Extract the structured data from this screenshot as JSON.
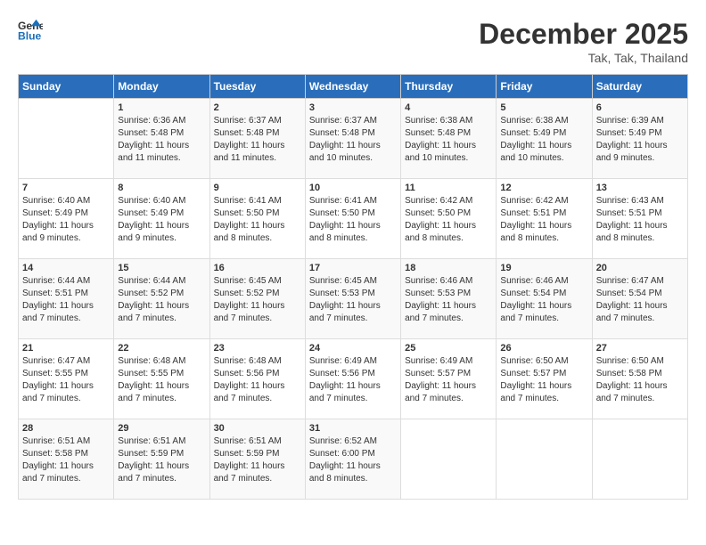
{
  "header": {
    "logo_line1": "General",
    "logo_line2": "Blue",
    "month_title": "December 2025",
    "location": "Tak, Tak, Thailand"
  },
  "weekdays": [
    "Sunday",
    "Monday",
    "Tuesday",
    "Wednesday",
    "Thursday",
    "Friday",
    "Saturday"
  ],
  "weeks": [
    [
      {
        "day": "",
        "sunrise": "",
        "sunset": "",
        "daylight": ""
      },
      {
        "day": "1",
        "sunrise": "6:36 AM",
        "sunset": "5:48 PM",
        "daylight": "11 hours and 11 minutes."
      },
      {
        "day": "2",
        "sunrise": "6:37 AM",
        "sunset": "5:48 PM",
        "daylight": "11 hours and 11 minutes."
      },
      {
        "day": "3",
        "sunrise": "6:37 AM",
        "sunset": "5:48 PM",
        "daylight": "11 hours and 10 minutes."
      },
      {
        "day": "4",
        "sunrise": "6:38 AM",
        "sunset": "5:48 PM",
        "daylight": "11 hours and 10 minutes."
      },
      {
        "day": "5",
        "sunrise": "6:38 AM",
        "sunset": "5:49 PM",
        "daylight": "11 hours and 10 minutes."
      },
      {
        "day": "6",
        "sunrise": "6:39 AM",
        "sunset": "5:49 PM",
        "daylight": "11 hours and 9 minutes."
      }
    ],
    [
      {
        "day": "7",
        "sunrise": "6:40 AM",
        "sunset": "5:49 PM",
        "daylight": "11 hours and 9 minutes."
      },
      {
        "day": "8",
        "sunrise": "6:40 AM",
        "sunset": "5:49 PM",
        "daylight": "11 hours and 9 minutes."
      },
      {
        "day": "9",
        "sunrise": "6:41 AM",
        "sunset": "5:50 PM",
        "daylight": "11 hours and 8 minutes."
      },
      {
        "day": "10",
        "sunrise": "6:41 AM",
        "sunset": "5:50 PM",
        "daylight": "11 hours and 8 minutes."
      },
      {
        "day": "11",
        "sunrise": "6:42 AM",
        "sunset": "5:50 PM",
        "daylight": "11 hours and 8 minutes."
      },
      {
        "day": "12",
        "sunrise": "6:42 AM",
        "sunset": "5:51 PM",
        "daylight": "11 hours and 8 minutes."
      },
      {
        "day": "13",
        "sunrise": "6:43 AM",
        "sunset": "5:51 PM",
        "daylight": "11 hours and 8 minutes."
      }
    ],
    [
      {
        "day": "14",
        "sunrise": "6:44 AM",
        "sunset": "5:51 PM",
        "daylight": "11 hours and 7 minutes."
      },
      {
        "day": "15",
        "sunrise": "6:44 AM",
        "sunset": "5:52 PM",
        "daylight": "11 hours and 7 minutes."
      },
      {
        "day": "16",
        "sunrise": "6:45 AM",
        "sunset": "5:52 PM",
        "daylight": "11 hours and 7 minutes."
      },
      {
        "day": "17",
        "sunrise": "6:45 AM",
        "sunset": "5:53 PM",
        "daylight": "11 hours and 7 minutes."
      },
      {
        "day": "18",
        "sunrise": "6:46 AM",
        "sunset": "5:53 PM",
        "daylight": "11 hours and 7 minutes."
      },
      {
        "day": "19",
        "sunrise": "6:46 AM",
        "sunset": "5:54 PM",
        "daylight": "11 hours and 7 minutes."
      },
      {
        "day": "20",
        "sunrise": "6:47 AM",
        "sunset": "5:54 PM",
        "daylight": "11 hours and 7 minutes."
      }
    ],
    [
      {
        "day": "21",
        "sunrise": "6:47 AM",
        "sunset": "5:55 PM",
        "daylight": "11 hours and 7 minutes."
      },
      {
        "day": "22",
        "sunrise": "6:48 AM",
        "sunset": "5:55 PM",
        "daylight": "11 hours and 7 minutes."
      },
      {
        "day": "23",
        "sunrise": "6:48 AM",
        "sunset": "5:56 PM",
        "daylight": "11 hours and 7 minutes."
      },
      {
        "day": "24",
        "sunrise": "6:49 AM",
        "sunset": "5:56 PM",
        "daylight": "11 hours and 7 minutes."
      },
      {
        "day": "25",
        "sunrise": "6:49 AM",
        "sunset": "5:57 PM",
        "daylight": "11 hours and 7 minutes."
      },
      {
        "day": "26",
        "sunrise": "6:50 AM",
        "sunset": "5:57 PM",
        "daylight": "11 hours and 7 minutes."
      },
      {
        "day": "27",
        "sunrise": "6:50 AM",
        "sunset": "5:58 PM",
        "daylight": "11 hours and 7 minutes."
      }
    ],
    [
      {
        "day": "28",
        "sunrise": "6:51 AM",
        "sunset": "5:58 PM",
        "daylight": "11 hours and 7 minutes."
      },
      {
        "day": "29",
        "sunrise": "6:51 AM",
        "sunset": "5:59 PM",
        "daylight": "11 hours and 7 minutes."
      },
      {
        "day": "30",
        "sunrise": "6:51 AM",
        "sunset": "5:59 PM",
        "daylight": "11 hours and 7 minutes."
      },
      {
        "day": "31",
        "sunrise": "6:52 AM",
        "sunset": "6:00 PM",
        "daylight": "11 hours and 8 minutes."
      },
      {
        "day": "",
        "sunrise": "",
        "sunset": "",
        "daylight": ""
      },
      {
        "day": "",
        "sunrise": "",
        "sunset": "",
        "daylight": ""
      },
      {
        "day": "",
        "sunrise": "",
        "sunset": "",
        "daylight": ""
      }
    ]
  ],
  "labels": {
    "sunrise_prefix": "Sunrise: ",
    "sunset_prefix": "Sunset: ",
    "daylight_prefix": "Daylight: "
  }
}
